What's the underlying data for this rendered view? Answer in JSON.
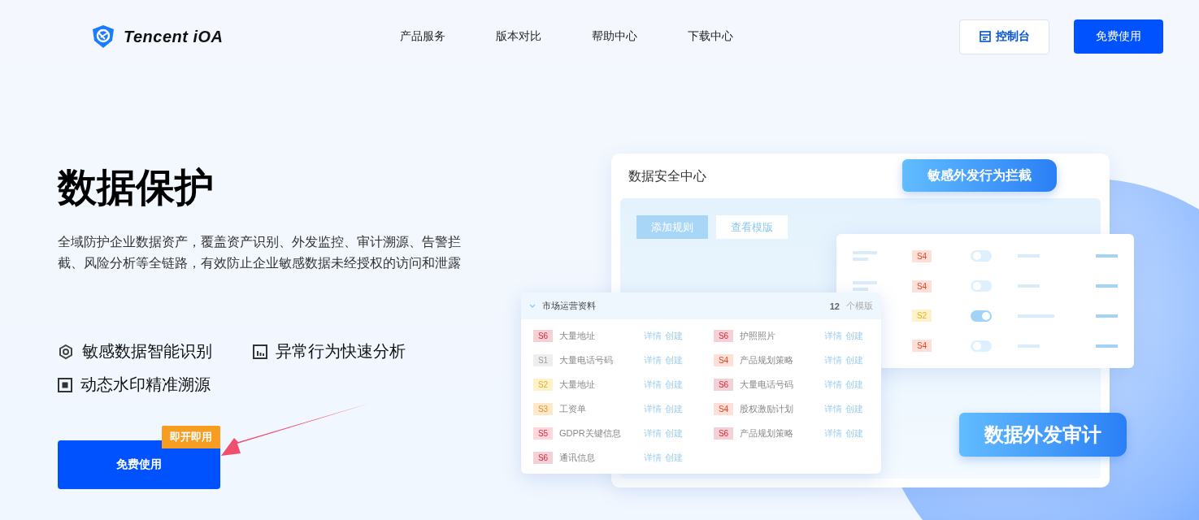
{
  "header": {
    "logo": "Tencent iOA",
    "nav": [
      "产品服务",
      "版本对比",
      "帮助中心",
      "下载中心"
    ],
    "console_button": "控制台",
    "cta_button": "免费使用"
  },
  "hero": {
    "title": "数据保护",
    "description": "全域防护企业数据资产，覆盖资产识别、外发监控、审计溯源、告警拦截、风险分析等全链路，有效防止企业敏感数据未经授权的访问和泄露",
    "features": [
      {
        "kind": "hexagon",
        "label": "敏感数据智能识别"
      },
      {
        "kind": "chart",
        "label": "异常行为快速分析"
      },
      {
        "kind": "frame",
        "label": "动态水印精准溯源"
      }
    ],
    "cta_button": "免费使用",
    "badge": "即开即用"
  },
  "illustration": {
    "panel_title": "数据安全中心",
    "banner_top": "敏感外发行为拦截",
    "buttons": [
      "添加规则",
      "查看模版"
    ],
    "rules": [
      {
        "tag": "S4",
        "color": "#ffe0d9",
        "on": false
      },
      {
        "tag": "S4",
        "color": "#ffe0d9",
        "on": false
      },
      {
        "tag": "S2",
        "color": "#fff1c9",
        "on": true
      },
      {
        "tag": "S4",
        "color": "#ffe0d9",
        "on": false
      }
    ],
    "list": {
      "title": "市场运营资料",
      "count": "12",
      "count_unit": "个模版",
      "items": [
        {
          "tag": "S6",
          "color": "#f2d2d6",
          "name": "大量地址",
          "actions": [
            "详情",
            "创建"
          ]
        },
        {
          "tag": "S6",
          "color": "#f2d2d6",
          "name": "护照照片",
          "actions": [
            "详情",
            "创建"
          ]
        },
        {
          "tag": "S1",
          "color": "#eeeeee",
          "name": "大量电话号码",
          "actions": [
            "详情",
            "创建"
          ]
        },
        {
          "tag": "S4",
          "color": "#ffe0d9",
          "name": "产品规划策略",
          "actions": [
            "详情",
            "创建"
          ]
        },
        {
          "tag": "S2",
          "color": "#fff1c9",
          "name": "大量地址",
          "actions": [
            "详情",
            "创建"
          ]
        },
        {
          "tag": "S6",
          "color": "#f2d2d6",
          "name": "大量电话号码",
          "actions": [
            "详情",
            "创建"
          ]
        },
        {
          "tag": "S3",
          "color": "#ffe9cc",
          "name": "工资单",
          "actions": [
            "详情",
            "创建"
          ]
        },
        {
          "tag": "S4",
          "color": "#ffe0d9",
          "name": "股权激励计划",
          "actions": [
            "详情",
            "创建"
          ]
        },
        {
          "tag": "S5",
          "color": "#ffd6db",
          "name": "GDPR关键信息",
          "actions": [
            "详情",
            "创建"
          ]
        },
        {
          "tag": "S6",
          "color": "#f2d2d6",
          "name": "产品规划策略",
          "actions": [
            "详情",
            "创建"
          ]
        },
        {
          "tag": "S6",
          "color": "#f2d2d6",
          "name": "通讯信息",
          "actions": [
            "详情",
            "创建"
          ]
        }
      ]
    },
    "banner_bottom": "数据外发审计"
  }
}
